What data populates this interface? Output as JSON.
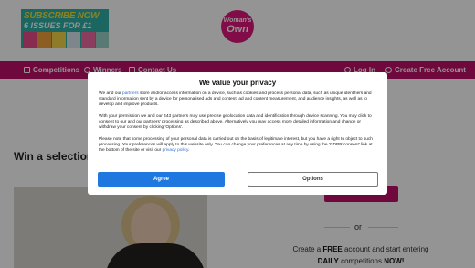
{
  "header": {
    "promo": {
      "line1": "SUBSCRIBE NOW",
      "line2": "6 ISSUES FOR £1"
    },
    "promo_cover_colors": [
      "#e84a8a",
      "#f2a33a",
      "#f4d64a",
      "#d8e8f0",
      "#ef6aa3",
      "#9ad0c8"
    ],
    "logo": {
      "top": "Woman's",
      "bottom": "Own"
    }
  },
  "nav": {
    "competitions": "Competitions",
    "winners": "Winners",
    "contact": "Contact Us",
    "login": "Log In",
    "create_account": "Create Free Account"
  },
  "page": {
    "article_title": "Win a selection of puzzles",
    "side_heading": "ers",
    "or_text": "or",
    "copy": {
      "part1": "Create a ",
      "free": "FREE",
      "part2": " account and start entering ",
      "daily": "DAILY",
      "part3": " competitions ",
      "now": "NOW!"
    }
  },
  "consent": {
    "title": "We value your privacy",
    "p1_a": "We and our ",
    "p1_link": "partners",
    "p1_b": " store and/or access information on a device, such as cookies and process personal data, such as unique identifiers and standard information sent by a device for personalised ads and content, ad and content measurement, and audience insights, as well as to develop and improve products.",
    "p2": "With your permission we and our 443 partners may use precise geolocation data and identification through device scanning. You may click to consent to our and our partners' processing as described above. Alternatively you may access more detailed information and change or withdraw your consent by clicking 'Options'.",
    "p3_a": "Please note that some processing of your personal data is carried out on the basis of legitimate interest, but you have a right to object to such processing. Your preferences will apply to this website only. You can change your preferences at any time by using the 'GDPR consent' link at the bottom of the site or visit our ",
    "p3_link": "privacy policy",
    "p3_b": ".",
    "agree": "Agree",
    "options": "Options"
  },
  "colors": {
    "brand_magenta": "#c0106a",
    "logo_pink": "#e0157a",
    "agree_blue": "#1f78e0"
  }
}
